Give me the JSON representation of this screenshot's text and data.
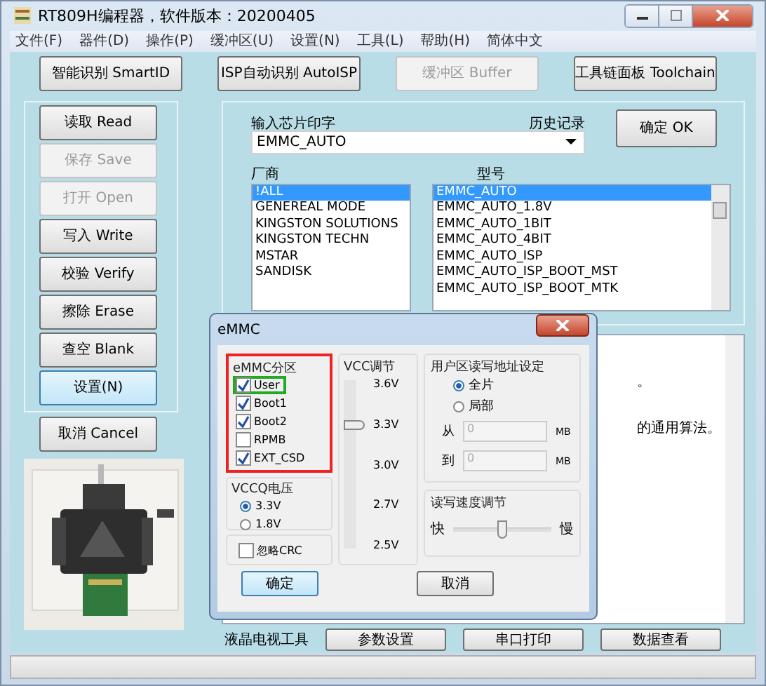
{
  "window": {
    "title": "RT809H编程器，软件版本：20200405"
  },
  "menu": [
    "文件(F)",
    "器件(D)",
    "操作(P)",
    "缓冲区(U)",
    "设置(N)",
    "工具(L)",
    "帮助(H)",
    "简体中文"
  ],
  "toolbar": [
    {
      "label": "智能识别 SmartID",
      "disabled": false
    },
    {
      "label": "ISP自动识别 AutoISP",
      "disabled": false
    },
    {
      "label": "缓冲区 Buffer",
      "disabled": true
    },
    {
      "label": "工具链面板 Toolchain",
      "disabled": false
    }
  ],
  "actions": [
    {
      "label": "读取 Read",
      "disabled": false,
      "focused": false
    },
    {
      "label": "保存 Save",
      "disabled": true,
      "focused": false
    },
    {
      "label": "打开 Open",
      "disabled": true,
      "focused": false
    },
    {
      "label": "写入 Write",
      "disabled": false,
      "focused": false
    },
    {
      "label": "校验 Verify",
      "disabled": false,
      "focused": false
    },
    {
      "label": "擦除 Erase",
      "disabled": false,
      "focused": false
    },
    {
      "label": "查空 Blank",
      "disabled": false,
      "focused": false
    },
    {
      "label": "设置(N)",
      "disabled": false,
      "focused": true
    }
  ],
  "cancel_button": "取消 Cancel",
  "device_photo": {
    "kind": "picture"
  },
  "chip_search": {
    "label": "输入芯片印字",
    "history_label": "历史记录",
    "value": "EMMC_AUTO",
    "ok_button": "确定 OK"
  },
  "manufacturers": {
    "label": "厂商",
    "items": [
      {
        "label": "!ALL",
        "selected": true
      },
      {
        "label": "GENEREAL MODE",
        "selected": false
      },
      {
        "label": "KINGSTON SOLUTIONS",
        "selected": false
      },
      {
        "label": "KINGSTON TECHN",
        "selected": false
      },
      {
        "label": "MSTAR",
        "selected": false
      },
      {
        "label": "SANDISK",
        "selected": false
      }
    ]
  },
  "models": {
    "label": "型号",
    "items": [
      {
        "label": "EMMC_AUTO",
        "selected": true
      },
      {
        "label": "EMMC_AUTO_1.8V",
        "selected": false
      },
      {
        "label": "EMMC_AUTO_1BIT",
        "selected": false
      },
      {
        "label": "EMMC_AUTO_4BIT",
        "selected": false
      },
      {
        "label": "EMMC_AUTO_ISP",
        "selected": false
      },
      {
        "label": "EMMC_AUTO_ISP_BOOT_MST",
        "selected": false
      },
      {
        "label": "EMMC_AUTO_ISP_BOOT_MTK",
        "selected": false
      }
    ]
  },
  "info_text": [
    "。",
    "的通用算法。"
  ],
  "bottom_tools": {
    "label": "液晶电视工具",
    "buttons": [
      "参数设置",
      "串口打印",
      "数据查看"
    ]
  },
  "dialog": {
    "title": "eMMC",
    "partition": {
      "label": "eMMC分区",
      "items": [
        {
          "label": "User",
          "checked": true,
          "highlighted": true
        },
        {
          "label": "Boot1",
          "checked": true,
          "highlighted": false
        },
        {
          "label": "Boot2",
          "checked": true,
          "highlighted": false
        },
        {
          "label": "RPMB",
          "checked": false,
          "highlighted": false
        },
        {
          "label": "EXT_CSD",
          "checked": true,
          "highlighted": false
        }
      ]
    },
    "vccq": {
      "label": "VCCQ电压",
      "options": [
        {
          "label": "3.3V",
          "selected": true
        },
        {
          "label": "1.8V",
          "selected": false
        }
      ]
    },
    "ignore_crc": {
      "label": "忽略CRC",
      "checked": false
    },
    "vcc": {
      "label": "VCC调节",
      "level": 0.73,
      "ticks": [
        "3.6V",
        "3.3V",
        "3.0V",
        "2.7V",
        "2.5V"
      ]
    },
    "address": {
      "label": "用户区读写地址设定",
      "options": [
        {
          "label": "全片",
          "selected": true
        },
        {
          "label": "局部",
          "selected": false
        }
      ],
      "from_label": "从",
      "from_value": "0",
      "to_label": "到",
      "to_value": "0",
      "from_unit": "MB",
      "to_unit": "MB"
    },
    "speed": {
      "label": "读写速度调节",
      "fast": "快",
      "slow": "慢",
      "level": 0.5
    },
    "ok": "确定",
    "cancel": "取消"
  }
}
